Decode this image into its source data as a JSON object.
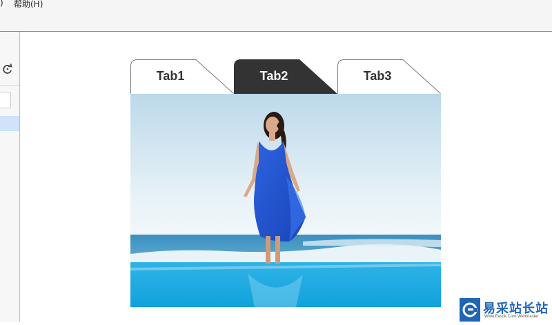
{
  "menubar": {
    "items": [
      {
        "label": ")"
      },
      {
        "label": "帮助(H)"
      }
    ]
  },
  "tabs": [
    {
      "label": "Tab1",
      "active": false
    },
    {
      "label": "Tab2",
      "active": true
    },
    {
      "label": "Tab3",
      "active": false
    }
  ],
  "colors": {
    "tab_active_bg": "#333333",
    "tab_active_text": "#ffffff",
    "tab_inactive_bg": "#ffffff",
    "tab_inactive_text": "#333333",
    "tab_border": "#777777"
  },
  "watermark": {
    "title": "易采站长站",
    "subtitle": "Www.Easck.Com Webmaster"
  }
}
